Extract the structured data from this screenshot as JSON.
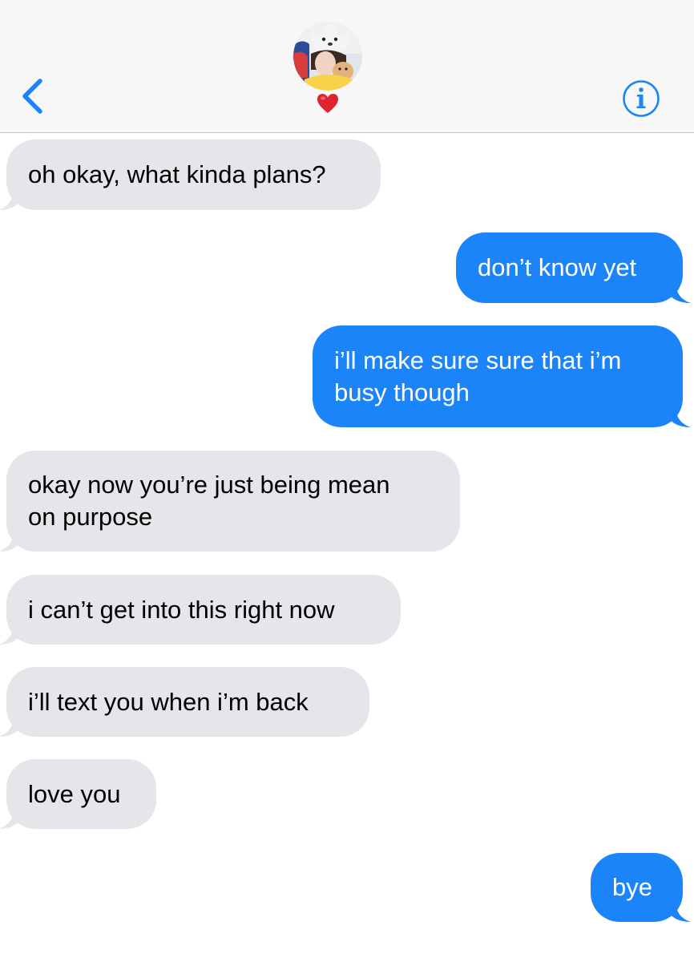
{
  "header": {
    "back_icon": "chevron-left-icon",
    "avatar_icon": "contact-avatar",
    "heart_icon": "red-heart-emoji",
    "info_icon": "info-icon",
    "accent_color": "#1b84f9"
  },
  "messages": [
    {
      "direction": "received",
      "text": "oh okay, what kinda plans?"
    },
    {
      "direction": "sent",
      "text": "don’t know yet"
    },
    {
      "direction": "sent",
      "text": "i’ll make sure sure that i’m\nbusy though"
    },
    {
      "direction": "received",
      "text": "okay now you’re just being mean\non purpose"
    },
    {
      "direction": "received",
      "text": "i can’t get into this right now"
    },
    {
      "direction": "received",
      "text": "i’ll text you when i’m back"
    },
    {
      "direction": "received",
      "text": "love you"
    },
    {
      "direction": "sent",
      "text": "bye"
    }
  ],
  "colors": {
    "received_bubble": "#e5e5ea",
    "sent_bubble": "#1b84f9",
    "header_bg": "#f7f7f7"
  }
}
